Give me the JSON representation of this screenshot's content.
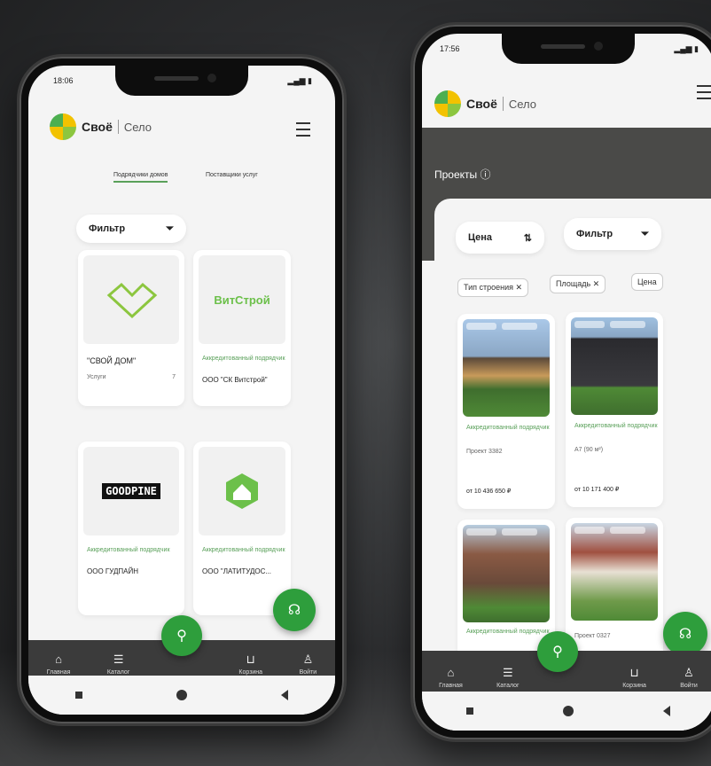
{
  "colors": {
    "accent": "#2e9e3c",
    "accent_text": "#5aa05a",
    "dark_bar": "#3b3b3b"
  },
  "left_phone": {
    "status_time": "18:06",
    "brand": {
      "name_a": "Своё",
      "name_b": "Село"
    },
    "tabs": [
      {
        "label": "Подрядчики домов",
        "active": true
      },
      {
        "label": "Поставщики услуг",
        "active": false
      }
    ],
    "filter_label": "Фильтр",
    "cards": [
      {
        "green": "",
        "title": "\"СВОЙ ДОМ\"",
        "sub": "Услуги",
        "count": "7",
        "logo": "heart-house-logo"
      },
      {
        "green": "Аккредитованный подрядчик",
        "title": "ООО \"СК Витстрой\"",
        "sub": "",
        "logo_text": "ВитСтрой"
      },
      {
        "green": "Аккредитованный подрядчик",
        "title": "ООО ГУДПАЙН",
        "sub": "",
        "logo_text": "GOODPINE"
      },
      {
        "green": "Аккредитованный подрядчик",
        "title": "ООО \"ЛАТИТУДОС...",
        "sub": "",
        "logo": "house-hex-logo"
      }
    ],
    "nav": [
      {
        "label": "Главная",
        "icon": "home-icon"
      },
      {
        "label": "Каталог",
        "icon": "catalog-icon"
      },
      {
        "label": "Корзина",
        "icon": "cart-icon"
      },
      {
        "label": "Войти",
        "icon": "user-icon"
      }
    ]
  },
  "right_phone": {
    "status_time": "17:56",
    "brand": {
      "name_a": "Своё",
      "name_b": "Село"
    },
    "section_title": "Проекты",
    "sort_label": "Цена",
    "filter_label": "Фильтр",
    "chips": [
      "Тип строения ✕",
      "Площадь ✕",
      "Цена"
    ],
    "cards": [
      {
        "green": "Аккредитованный подрядчик",
        "title": "Проект 3382",
        "price": "от 10 436 650 ₽"
      },
      {
        "green": "Аккредитованный подрядчик",
        "title": "А7 (90 м²)",
        "price": "от 10 171 400 ₽"
      },
      {
        "green": "Аккредитованный подрядчик",
        "title": "",
        "price": ""
      },
      {
        "green": "",
        "title": "Проект 0327",
        "price": ""
      }
    ],
    "nav": [
      {
        "label": "Главная",
        "icon": "home-icon"
      },
      {
        "label": "Каталог",
        "icon": "catalog-icon"
      },
      {
        "label": "Корзина",
        "icon": "cart-icon"
      },
      {
        "label": "Войти",
        "icon": "user-icon"
      }
    ]
  }
}
